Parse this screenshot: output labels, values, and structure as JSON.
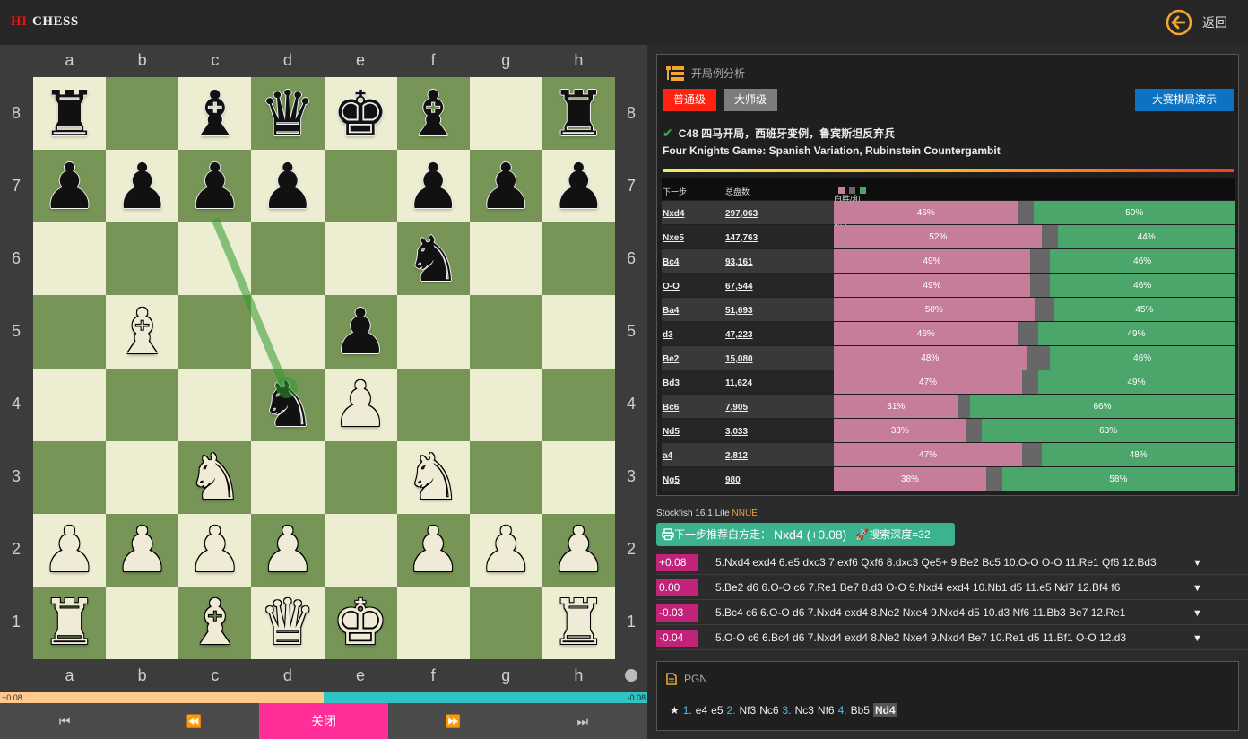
{
  "app": {
    "logo_a": "HI-",
    "logo_b": "CHESS",
    "back_label": "返回"
  },
  "board": {
    "files": [
      "a",
      "b",
      "c",
      "d",
      "e",
      "f",
      "g",
      "h"
    ],
    "ranks": [
      "8",
      "7",
      "6",
      "5",
      "4",
      "3",
      "2",
      "1"
    ],
    "pieces": [
      {
        "sq": "a8",
        "p": "r"
      },
      {
        "sq": "c8",
        "p": "b"
      },
      {
        "sq": "d8",
        "p": "q"
      },
      {
        "sq": "e8",
        "p": "k"
      },
      {
        "sq": "f8",
        "p": "b"
      },
      {
        "sq": "h8",
        "p": "r"
      },
      {
        "sq": "a7",
        "p": "p"
      },
      {
        "sq": "b7",
        "p": "p"
      },
      {
        "sq": "c7",
        "p": "p"
      },
      {
        "sq": "d7",
        "p": "p"
      },
      {
        "sq": "f7",
        "p": "p"
      },
      {
        "sq": "g7",
        "p": "p"
      },
      {
        "sq": "h7",
        "p": "p"
      },
      {
        "sq": "f6",
        "p": "n"
      },
      {
        "sq": "b5",
        "p": "B"
      },
      {
        "sq": "e5",
        "p": "p"
      },
      {
        "sq": "d4",
        "p": "n"
      },
      {
        "sq": "e4",
        "p": "P"
      },
      {
        "sq": "c3",
        "p": "N"
      },
      {
        "sq": "f3",
        "p": "N"
      },
      {
        "sq": "a2",
        "p": "P"
      },
      {
        "sq": "b2",
        "p": "P"
      },
      {
        "sq": "c2",
        "p": "P"
      },
      {
        "sq": "d2",
        "p": "P"
      },
      {
        "sq": "f2",
        "p": "P"
      },
      {
        "sq": "g2",
        "p": "P"
      },
      {
        "sq": "h2",
        "p": "P"
      },
      {
        "sq": "a1",
        "p": "R"
      },
      {
        "sq": "c1",
        "p": "B"
      },
      {
        "sq": "d1",
        "p": "Q"
      },
      {
        "sq": "e1",
        "p": "K"
      },
      {
        "sq": "h1",
        "p": "R"
      }
    ],
    "last_move_arrow": {
      "from": "c6",
      "to": "d4",
      "color": "#2f9a2f"
    }
  },
  "eval_bar": {
    "white_fraction": 0.5,
    "left_label": "+0.08",
    "right_label": "-0.08"
  },
  "nav": {
    "first": "⏮",
    "prev": "⏪",
    "close": "关闭",
    "next": "⏩",
    "last": "⏭"
  },
  "opening": {
    "title": "开局例分析",
    "level_normal": "普通级",
    "level_master": "大师级",
    "demo": "大赛棋局演示",
    "name_cn": "C48 四马开局，西班牙变例，鲁宾斯坦反弃兵",
    "name_en": "Four Knights Game: Spanish Variation, Rubinstein Countergambit",
    "col_move": "下一步",
    "col_total": "总盘数",
    "col_ratio": "白胜/和棋/黑胜比率",
    "colors": {
      "white_win": "#c57d99",
      "draw": "#676767",
      "black_win": "#4aa66b"
    },
    "rows": [
      {
        "move": "Nxd4",
        "total": "297,063",
        "w": 46,
        "b": 50
      },
      {
        "move": "Nxe5",
        "total": "147,763",
        "w": 52,
        "b": 44
      },
      {
        "move": "Bc4",
        "total": "93,161",
        "w": 49,
        "b": 46
      },
      {
        "move": "O-O",
        "total": "67,544",
        "w": 49,
        "b": 46
      },
      {
        "move": "Ba4",
        "total": "51,693",
        "w": 50,
        "b": 45
      },
      {
        "move": "d3",
        "total": "47,223",
        "w": 46,
        "b": 49
      },
      {
        "move": "Be2",
        "total": "15,080",
        "w": 48,
        "b": 46
      },
      {
        "move": "Bd3",
        "total": "11,624",
        "w": 47,
        "b": 49
      },
      {
        "move": "Bc6",
        "total": "7,905",
        "w": 31,
        "b": 66
      },
      {
        "move": "Nd5",
        "total": "3,033",
        "w": 33,
        "b": 63
      },
      {
        "move": "a4",
        "total": "2,812",
        "w": 47,
        "b": 48
      },
      {
        "move": "Ng5",
        "total": "980",
        "w": 38,
        "b": 58
      }
    ]
  },
  "engine": {
    "name": "Stockfish 16.1 Lite",
    "nnue": "NNUE",
    "rec_prefix": "下一步推荐白方走：",
    "rec_move": "Nxd4 (+0.08)",
    "rec_depth": "搜索深度=32",
    "lines": [
      {
        "score": "+0.08",
        "text": "5.Nxd4 exd4 6.e5 dxc3 7.exf6 Qxf6 8.dxc3 Qe5+ 9.Be2 Bc5 10.O-O O-O 11.Re1 Qf6 12.Bd3"
      },
      {
        "score": "0.00",
        "text": "5.Be2 d6 6.O-O c6 7.Re1 Be7 8.d3 O-O 9.Nxd4 exd4 10.Nb1 d5 11.e5 Nd7 12.Bf4 f6"
      },
      {
        "score": "-0.03",
        "text": "5.Bc4 c6 6.O-O d6 7.Nxd4 exd4 8.Ne2 Nxe4 9.Nxd4 d5 10.d3 Nf6 11.Bb3 Be7 12.Re1"
      },
      {
        "score": "-0.04",
        "text": "5.O-O c6 6.Bc4 d6 7.Nxd4 exd4 8.Ne2 Nxe4 9.Nxd4 Be7 10.Re1 d5 11.Bf1 O-O 12.d3"
      }
    ]
  },
  "pgn": {
    "title": "PGN",
    "star": "★",
    "moves": [
      {
        "num": "1.",
        "w": "e4",
        "b": "e5"
      },
      {
        "num": "2.",
        "w": "Nf3",
        "b": "Nc6"
      },
      {
        "num": "3.",
        "w": "Nc3",
        "b": "Nf6"
      },
      {
        "num": "4.",
        "w": "Bb5",
        "b": "Nd4"
      }
    ]
  }
}
